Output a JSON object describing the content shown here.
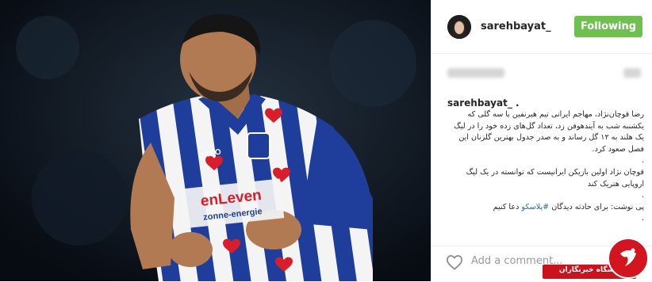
{
  "header": {
    "username": "sarehbayat_",
    "follow_label": "Following"
  },
  "caption": {
    "username": "sarehbayat_",
    "dot1": ".",
    "paragraph1": "رضا قوچان‌نژاد، مهاجم ایرانی تیم هیرنفین با سه گلی که یکشنبه شب به آیندهوفن زد، تعداد گل‌های زده خود را در لیگ یک هلند به ۱۲ گل رساند و به صدر جدول بهترین گلزنان این فصل صعود کرد.",
    "dot2": ".",
    "paragraph2": "قوچان نژاد اولین بازیکن ایرانیست که توانسته در یک لیگ اروپایی هتریک کند",
    "dot3": ".",
    "line3_text": "پی نوشت: برای حادثه دیدگان",
    "hashtag": "#پلاسکو",
    "line3_end": "دعا کنیم",
    "dot4": "."
  },
  "footer": {
    "comment_placeholder": "Add a comment..."
  },
  "watermark": {
    "text": "باشگاه خبرنگاران"
  },
  "colors": {
    "follow_bg": "#70c050",
    "hashtag": "#1a6fb5",
    "badge_red": "#c9141e",
    "jersey_blue": "#1f3d9a"
  },
  "icons": {
    "like": "heart-icon",
    "watermark": "yjc-logo"
  }
}
